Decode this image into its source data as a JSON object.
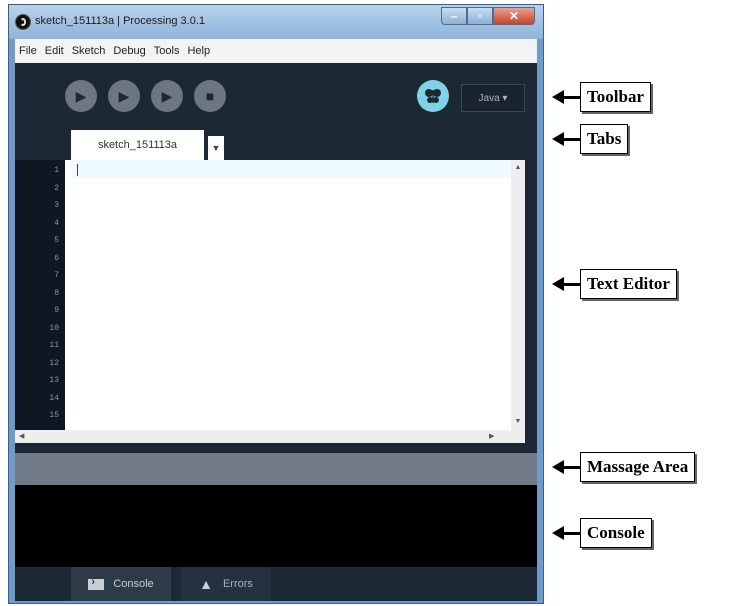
{
  "window": {
    "title": "sketch_151113a | Processing 3.0.1",
    "controls": {
      "minimize": "–",
      "maximize": "▫",
      "close": "✕"
    }
  },
  "menubar": {
    "items": [
      "File",
      "Edit",
      "Sketch",
      "Debug",
      "Tools",
      "Help"
    ]
  },
  "toolbar": {
    "buttons": [
      {
        "name": "run",
        "icon": "play-icon",
        "glyph": "▶"
      },
      {
        "name": "stop-sketch",
        "icon": "step-icon",
        "glyph": "▶"
      },
      {
        "name": "continue",
        "icon": "continue-icon",
        "glyph": "▶"
      },
      {
        "name": "stop",
        "icon": "stop-icon",
        "glyph": "■"
      }
    ],
    "debugger_icon": "butterfly-icon",
    "debugger_glyph": "ߎ",
    "mode_label": "Java ▾"
  },
  "tabs": {
    "active": "sketch_151113a",
    "menu_glyph": "▼"
  },
  "editor": {
    "line_numbers": [
      "1",
      "2",
      "3",
      "4",
      "5",
      "6",
      "7",
      "8",
      "9",
      "10",
      "11",
      "12",
      "13",
      "14",
      "15"
    ],
    "content": ""
  },
  "footer": {
    "console_label": "Console",
    "errors_label": "Errors"
  },
  "annotations": [
    {
      "label": "Toolbar"
    },
    {
      "label": "Tabs"
    },
    {
      "label": "Text Editor"
    },
    {
      "label": "Massage Area"
    },
    {
      "label": "Console"
    }
  ],
  "colors": {
    "window_frame": "#6f9bc6",
    "toolbar_bg": "#1d2835",
    "button_grey": "#6d7783",
    "debugger_cyan": "#7fd3e6",
    "message_area": "#6f7a86",
    "console_bg": "#000000"
  }
}
